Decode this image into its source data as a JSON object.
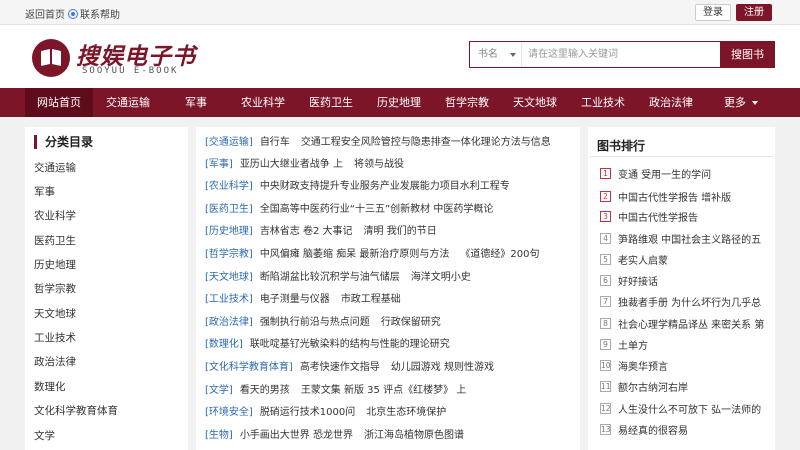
{
  "topbar": {
    "home_link": "返回首页",
    "help_link": "联系帮助",
    "login_label": "登录",
    "register_label": "注册"
  },
  "logo": {
    "name_cn": "搜娱电子书",
    "name_en": "SOOYUU E-BOOK"
  },
  "search": {
    "category": "书名",
    "placeholder": "请在这里输入关键词",
    "button_label": "搜图书"
  },
  "nav": {
    "items": [
      "网站首页",
      "交通运输",
      "军事",
      "农业科学",
      "医药卫生",
      "历史地理",
      "哲学宗教",
      "天文地球",
      "工业技术",
      "政治法律",
      "更多"
    ],
    "active_index": 0
  },
  "categories": {
    "title": "分类目录",
    "items": [
      "交通运输",
      "军事",
      "农业科学",
      "医药卫生",
      "历史地理",
      "哲学宗教",
      "天文地球",
      "工业技术",
      "政治法律",
      "数理化",
      "文化科学教育体育",
      "文学"
    ]
  },
  "books": [
    {
      "tag": "[交通运输]",
      "items": [
        "自行车",
        "交通工程安全风险管控与隐患排查一体化理论方法与信息"
      ]
    },
    {
      "tag": "[军事]",
      "items": [
        "亚历山大继业者战争 上",
        "将领与战役"
      ]
    },
    {
      "tag": "[农业科学]",
      "items": [
        "中央财政支持提升专业服务产业发展能力项目水利工程专"
      ]
    },
    {
      "tag": "[医药卫生]",
      "items": [
        "全国高等中医药行业“十三五”创新教材 中医药学概论"
      ]
    },
    {
      "tag": "[历史地理]",
      "items": [
        "吉林省志 卷2 大事记",
        "清明 我们的节日"
      ]
    },
    {
      "tag": "[哲学宗教]",
      "items": [
        "中风偏瘫 脑萎缩 痴呆 最新治疗原则与方法",
        "《道德经》200句"
      ]
    },
    {
      "tag": "[天文地球]",
      "items": [
        "断陷湖盆比较沉积学与油气储层",
        "海洋文明小史"
      ]
    },
    {
      "tag": "[工业技术]",
      "items": [
        "电子测量与仪器",
        "市政工程基础"
      ]
    },
    {
      "tag": "[政治法律]",
      "items": [
        "强制执行前沿与热点问题",
        "行政保留研究"
      ]
    },
    {
      "tag": "[数理化]",
      "items": [
        "联吡啶基钌光敏染料的结构与性能的理论研究"
      ]
    },
    {
      "tag": "[文化科学教育体育]",
      "items": [
        "高考快速作文指导",
        "幼儿园游戏 规则性游戏"
      ]
    },
    {
      "tag": "[文学]",
      "items": [
        "看天的男孩",
        "王蒙文集 新版 35 评点《红楼梦》 上"
      ]
    },
    {
      "tag": "[环境安全]",
      "items": [
        "脱硝运行技术1000问",
        "北京生态环境保护"
      ]
    },
    {
      "tag": "[生物]",
      "items": [
        "小手画出大世界 恐龙世界",
        "浙江海岛植物原色图谱"
      ]
    }
  ],
  "ranking": {
    "title": "图书排行",
    "items": [
      {
        "num": "1",
        "title": "变通 受用一生的学问"
      },
      {
        "num": "2",
        "title": "中国古代性学报告 增补版"
      },
      {
        "num": "3",
        "title": "中国古代性学报告"
      },
      {
        "num": "4",
        "title": "笋路维艰 中国社会主义路径的五"
      },
      {
        "num": "5",
        "title": "老实人启蒙"
      },
      {
        "num": "6",
        "title": "好好接话"
      },
      {
        "num": "7",
        "title": "独裁者手册 为什么坏行为几乎总"
      },
      {
        "num": "8",
        "title": "社会心理学精品译丛 来密关系 第"
      },
      {
        "num": "9",
        "title": "土单方"
      },
      {
        "num": "10",
        "title": "海奥华预言"
      },
      {
        "num": "11",
        "title": "额尔古纳河右岸"
      },
      {
        "num": "12",
        "title": "人生没什么不可放下 弘一法师的"
      },
      {
        "num": "13",
        "title": "易经真的很容易"
      }
    ]
  },
  "colors": {
    "brand": "#7d1529",
    "nav_active": "#5e0c1c",
    "tag_link": "#2d6ab0",
    "rank_top": "#c3323e"
  }
}
